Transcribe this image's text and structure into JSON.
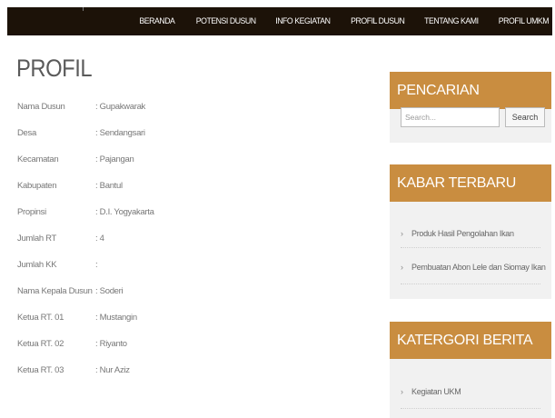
{
  "nav": {
    "items": [
      "BERANDA",
      "POTENSI DUSUN",
      "INFO KEGIATAN",
      "PROFIL DUSUN",
      "TENTANG KAMI",
      "PROFIL UMKM"
    ]
  },
  "page": {
    "title": "PROFIL"
  },
  "profile": {
    "rows": [
      {
        "label": "Nama Dusun",
        "value": ": Gupakwarak"
      },
      {
        "label": "Desa",
        "value": ": Sendangsari"
      },
      {
        "label": "Kecamatan",
        "value": ": Pajangan"
      },
      {
        "label": "Kabupaten",
        "value": ": Bantul"
      },
      {
        "label": "Propinsi",
        "value": ": D.I. Yogyakarta"
      },
      {
        "label": "Jumlah RT",
        "value": ": 4"
      },
      {
        "label": "Jumlah KK",
        "value": ":"
      },
      {
        "label": "Nama Kepala Dusun",
        "value": ": Soderi"
      },
      {
        "label": "Ketua RT. 01",
        "value": ": Mustangin"
      },
      {
        "label": "Ketua RT. 02",
        "value": ": Riyanto"
      },
      {
        "label": "Ketua RT. 03",
        "value": ": Nur Aziz"
      }
    ]
  },
  "sidebar": {
    "search": {
      "title": "PENCARIAN",
      "placeholder": "Search...",
      "button": "Search"
    },
    "news": {
      "title": "KABAR TERBARU",
      "items": [
        "Produk Hasil Pengolahan Ikan",
        "Pembuatan Abon Lele dan Siomay Ikan"
      ]
    },
    "categories": {
      "title": "KATERGORI BERITA",
      "items": [
        "Kegiatan UKM"
      ]
    },
    "chevron": "›"
  },
  "colors": {
    "header_bg": "#1c1208",
    "accent": "#c98d40",
    "sidebar_bg": "#f1f1f1"
  }
}
